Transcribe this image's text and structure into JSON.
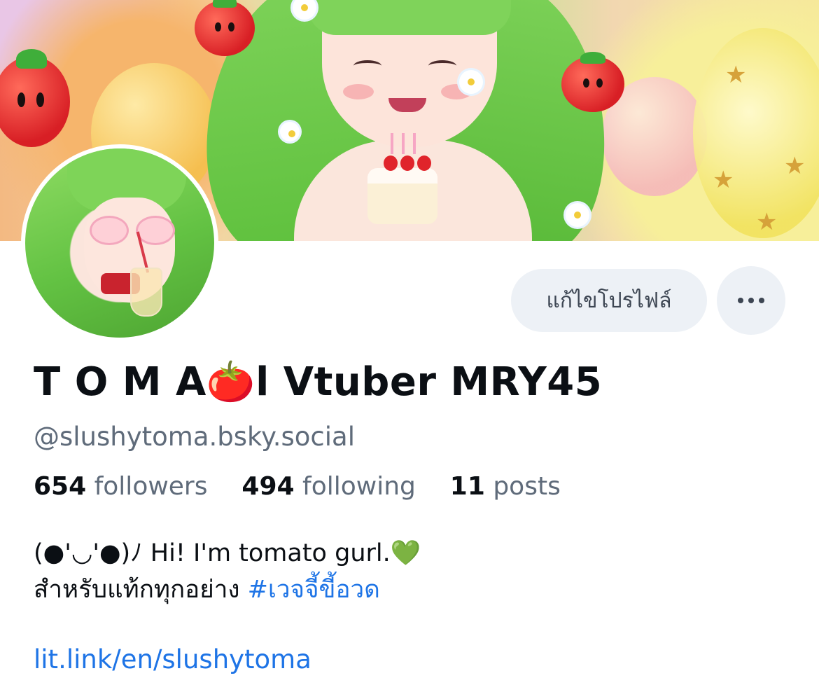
{
  "profile": {
    "display_name": "T O M A🍅l Vtuber MRY45",
    "handle": "@slushytoma.bsky.social",
    "followers_count": "654",
    "followers_label": "followers",
    "following_count": "494",
    "following_label": "following",
    "posts_count": "11",
    "posts_label": "posts",
    "bio_line1": "(●'◡'●)ﾉ Hi! I'm tomato gurl.💚",
    "bio_line2_text": "สำหรับแท้กทุกอย่าง ",
    "bio_hashtag": "#เวจจี้ขี้อวด",
    "link": "lit.link/en/slushytoma"
  },
  "actions": {
    "edit_profile_label": "แก้ไขโปรไฟล์",
    "more_icon": "more-horizontal-icon"
  },
  "colors": {
    "link": "#1e74e6",
    "muted_text": "#5f6b7a",
    "button_bg": "#edf1f6"
  }
}
